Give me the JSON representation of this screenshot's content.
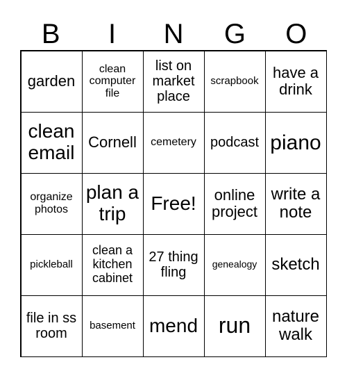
{
  "header": [
    "B",
    "I",
    "N",
    "G",
    "O"
  ],
  "cells": [
    [
      "garden",
      "clean computer file",
      "list on market place",
      "scrapbook",
      "have a drink"
    ],
    [
      "clean email",
      "Cornell",
      "cemetery",
      "podcast",
      "piano"
    ],
    [
      "organize photos",
      "plan a trip",
      "Free!",
      "online project",
      "write a note"
    ],
    [
      "pickleball",
      "clean a kitchen cabinet",
      "27 thing fling",
      "genealogy",
      "sketch"
    ],
    [
      "file in ss room",
      "basement",
      "mend",
      "run",
      "nature walk"
    ]
  ]
}
